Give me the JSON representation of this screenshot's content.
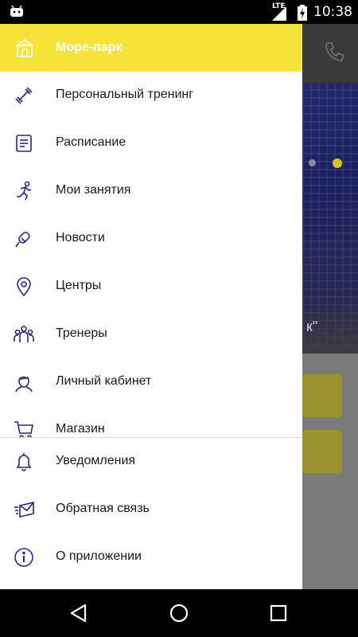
{
  "status_bar": {
    "network": "LTE",
    "time": "10:38"
  },
  "drawer": {
    "header_label": "Море-парк",
    "items": [
      {
        "label": "Персональный тренинг",
        "icon": "dumbbell-icon"
      },
      {
        "label": "Расписание",
        "icon": "document-icon"
      },
      {
        "label": "Мои занятия",
        "icon": "running-person-icon"
      },
      {
        "label": "Новости",
        "icon": "megaphone-icon"
      },
      {
        "label": "Центры",
        "icon": "location-pin-icon"
      },
      {
        "label": "Тренеры",
        "icon": "group-icon"
      },
      {
        "label": "Личный кабинет",
        "icon": "person-icon"
      },
      {
        "label": "Магазин",
        "icon": "cart-icon"
      }
    ],
    "bottom_items": [
      {
        "label": "Уведомления",
        "icon": "bell-icon"
      },
      {
        "label": "Обратная связь",
        "icon": "mail-icon"
      },
      {
        "label": "О приложении",
        "icon": "info-icon"
      }
    ]
  },
  "background": {
    "quote_fragment": "к\""
  },
  "colors": {
    "accent": "#f7e43b",
    "icon": "#2a2480"
  }
}
